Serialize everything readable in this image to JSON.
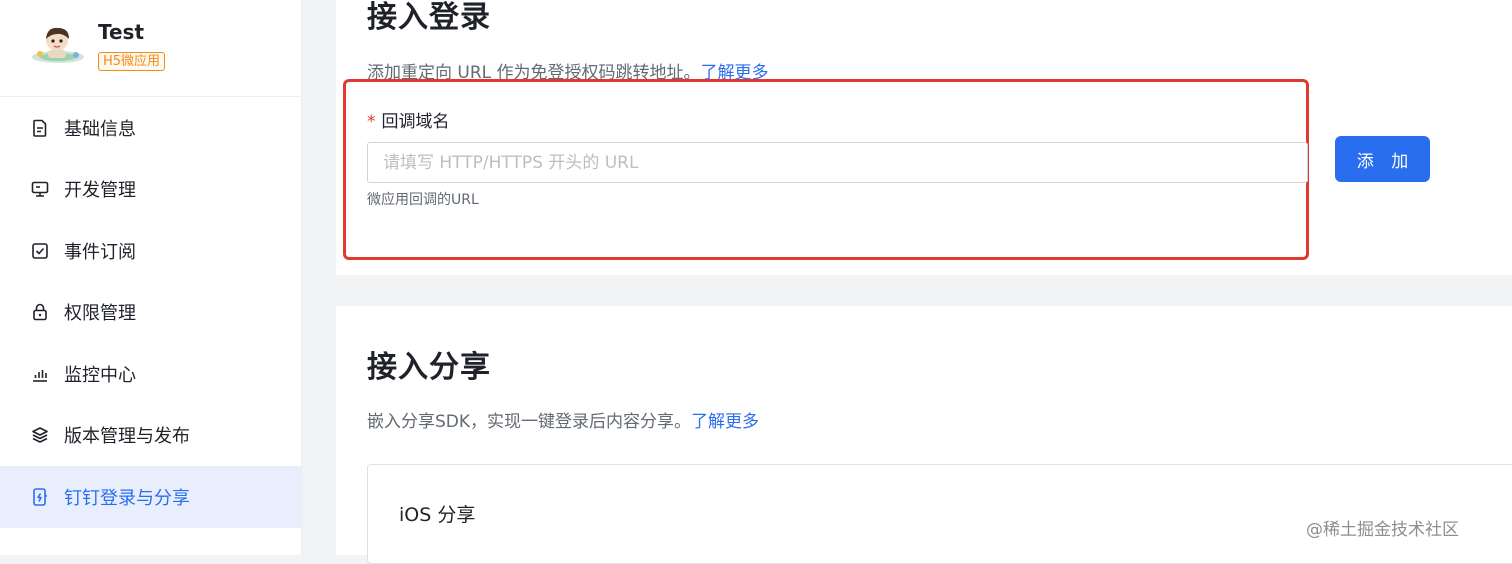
{
  "app": {
    "name": "Test",
    "badge": "H5微应用"
  },
  "sidebar": {
    "items": [
      {
        "label": "基础信息",
        "icon": "document-icon"
      },
      {
        "label": "开发管理",
        "icon": "monitor-icon"
      },
      {
        "label": "事件订阅",
        "icon": "checkbox-icon"
      },
      {
        "label": "权限管理",
        "icon": "lock-icon"
      },
      {
        "label": "监控中心",
        "icon": "bar-chart-icon"
      },
      {
        "label": "版本管理与发布",
        "icon": "layers-icon"
      },
      {
        "label": "钉钉登录与分享",
        "icon": "phone-lightning-icon",
        "active": true
      }
    ]
  },
  "login_section": {
    "title": "接入登录",
    "desc": "添加重定向 URL 作为免登授权码跳转地址。",
    "learn_more": "了解更多",
    "field": {
      "required_mark": "*",
      "label": "回调域名",
      "placeholder": "请填写 HTTP/HTTPS 开头的 URL",
      "value": "",
      "help": "微应用回调的URL"
    },
    "add_button": "添 加"
  },
  "share_section": {
    "title": "接入分享",
    "desc": "嵌入分享SDK，实现一键登录后内容分享。",
    "learn_more": "了解更多",
    "ios_title": "iOS 分享"
  },
  "watermark": "@稀土掘金技术社区",
  "colors": {
    "accent": "#2a6ef0",
    "highlight_box": "#e0392f",
    "badge": "#f08c1a"
  }
}
